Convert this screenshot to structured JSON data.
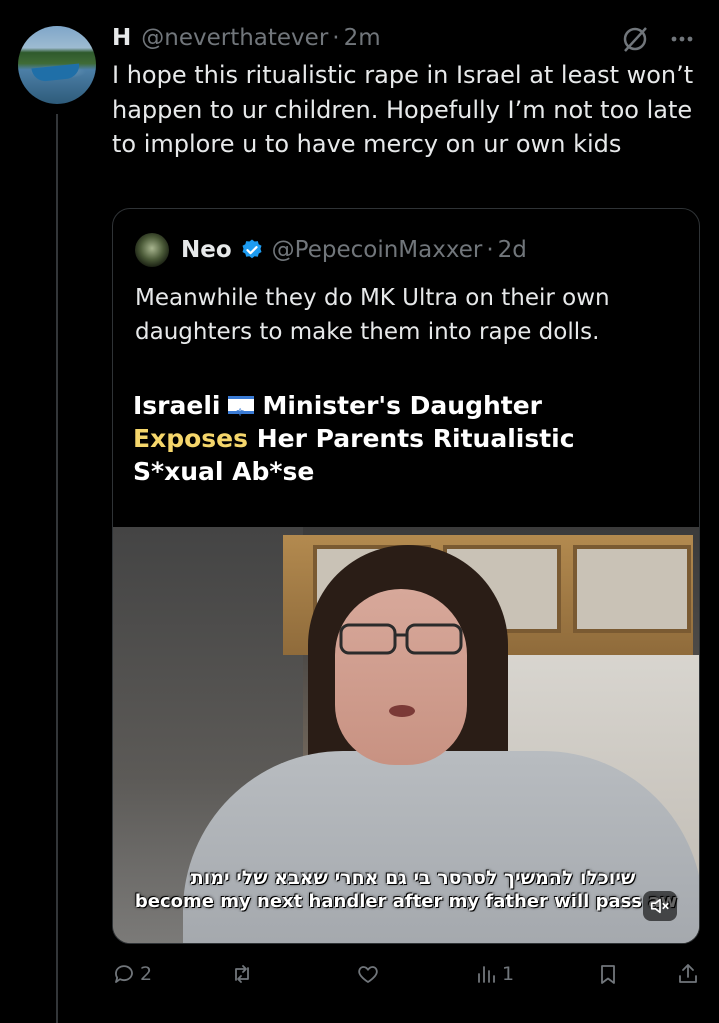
{
  "tweet": {
    "author_name": "H",
    "handle": "@neverthatever",
    "separator": "·",
    "time": "2m",
    "text": "I hope this ritualistic rape in Israel at least won’t happen to ur children. Hopefully I’m not too late to implore u to have mercy on ur own kids"
  },
  "quoted_tweet": {
    "author_name": "Neo",
    "handle": "@PepecoinMaxxer",
    "separator": "·",
    "time": "2d",
    "text": "Meanwhile they do MK Ultra on their own daughters to make them into rape dolls.",
    "media": {
      "headline_line1_a": "Israeli",
      "headline_line1_b": "Minister's Daughter",
      "headline_line2_yellow": "Exposes",
      "headline_line2_rest": " Her Parents Ritualistic",
      "headline_line3": "S*xual Ab*se",
      "subtitle_hebrew": "שיוכלו להמשיך לסרסר בי גם אחרי שאבא שלי ימות",
      "subtitle_english": "become my next handler after my father will pass aw"
    }
  },
  "actions": {
    "replies": "2",
    "reposts": "",
    "likes": "",
    "views": "1"
  },
  "colors": {
    "background": "#000000",
    "text": "#e7e9ea",
    "muted": "#71767b",
    "verified": "#1d9bf0",
    "headline_yellow": "#f5d66b"
  },
  "icons": [
    "grok-icon",
    "more-icon",
    "verified-badge-icon",
    "reply-icon",
    "repost-icon",
    "like-icon",
    "views-icon",
    "bookmark-icon",
    "share-icon",
    "mute-icon"
  ]
}
